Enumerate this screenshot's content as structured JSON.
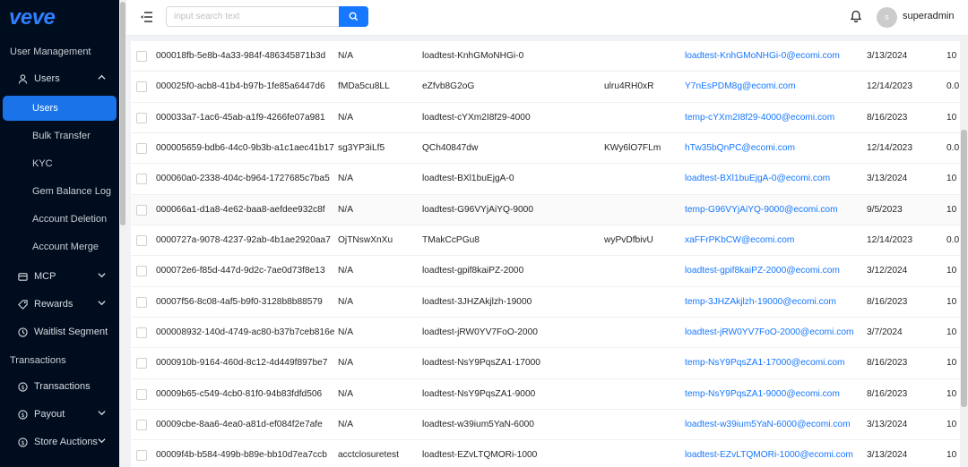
{
  "app": {
    "logo": "veve"
  },
  "sidebar": {
    "section_user_management": "User Management",
    "users_group": "Users",
    "sub_items": [
      "Users",
      "Bulk Transfer",
      "KYC",
      "Gem Balance Log",
      "Account Deletion",
      "Account Merge"
    ],
    "mcp": "MCP",
    "rewards": "Rewards",
    "waitlist": "Waitlist Segment",
    "section_transactions": "Transactions",
    "transactions": "Transactions",
    "payout": "Payout",
    "store_auctions": "Store Auctions"
  },
  "header": {
    "search_placeholder": "input search text",
    "username": "superadmin",
    "avatar_letter": "s"
  },
  "rows": [
    {
      "id": "000018fb-5e8b-4a33-984f-486345871b3d",
      "f2": "N/A",
      "f3": "loadtest-KnhGMoNHGi-0",
      "f4": "",
      "email": "loadtest-KnhGMoNHGi-0@ecomi.com",
      "date": "3/13/2024",
      "v": "10"
    },
    {
      "id": "000025f0-acb8-41b4-b97b-1fe85a6447d6",
      "f2": "fMDa5cu8LL",
      "f3": "eZfvb8G2oG",
      "f4": "ulru4RH0xR",
      "email": "Y7nEsPDM8g@ecomi.com",
      "date": "12/14/2023",
      "v": "0.0"
    },
    {
      "id": "000033a7-1ac6-45ab-a1f9-4266fe07a981",
      "f2": "N/A",
      "f3": "loadtest-cYXm2I8f29-4000",
      "f4": "",
      "email": "temp-cYXm2I8f29-4000@ecomi.com",
      "date": "8/16/2023",
      "v": "10"
    },
    {
      "id": "000005659-bdb6-44c0-9b3b-a1c1aec41b17",
      "f2": "sg3YP3iLf5",
      "f3": "QCh40847dw",
      "f4": "KWy6lO7FLm",
      "email": "hTw35bQnPC@ecomi.com",
      "date": "12/14/2023",
      "v": "0.0"
    },
    {
      "id": "000060a0-2338-404c-b964-1727685c7ba5",
      "f2": "N/A",
      "f3": "loadtest-BXl1buEjgA-0",
      "f4": "",
      "email": "loadtest-BXl1buEjgA-0@ecomi.com",
      "date": "3/13/2024",
      "v": "10"
    },
    {
      "id": "000066a1-d1a8-4e62-baa8-aefdee932c8f",
      "f2": "N/A",
      "f3": "loadtest-G96VYjAiYQ-9000",
      "f4": "",
      "email": "temp-G96VYjAiYQ-9000@ecomi.com",
      "date": "9/5/2023",
      "v": "10"
    },
    {
      "id": "0000727a-9078-4237-92ab-4b1ae2920aa7",
      "f2": "OjTNswXnXu",
      "f3": "TMakCcPGu8",
      "f4": "wyPvDfbivU",
      "email": "xaFFrPKbCW@ecomi.com",
      "date": "12/14/2023",
      "v": "0.0"
    },
    {
      "id": "000072e6-f85d-447d-9d2c-7ae0d73f8e13",
      "f2": "N/A",
      "f3": "loadtest-gpif8kaiPZ-2000",
      "f4": "",
      "email": "loadtest-gpif8kaiPZ-2000@ecomi.com",
      "date": "3/12/2024",
      "v": "10"
    },
    {
      "id": "00007f56-8c08-4af5-b9f0-3128b8b88579",
      "f2": "N/A",
      "f3": "loadtest-3JHZAkjlzh-19000",
      "f4": "",
      "email": "temp-3JHZAkjlzh-19000@ecomi.com",
      "date": "8/16/2023",
      "v": "10"
    },
    {
      "id": "000008932-140d-4749-ac80-b37b7ceb816e",
      "f2": "N/A",
      "f3": "loadtest-jRW0YV7FoO-2000",
      "f4": "",
      "email": "loadtest-jRW0YV7FoO-2000@ecomi.com",
      "date": "3/7/2024",
      "v": "10"
    },
    {
      "id": "0000910b-9164-460d-8c12-4d449f897be7",
      "f2": "N/A",
      "f3": "loadtest-NsY9PqsZA1-17000",
      "f4": "",
      "email": "temp-NsY9PqsZA1-17000@ecomi.com",
      "date": "8/16/2023",
      "v": "10"
    },
    {
      "id": "00009b65-c549-4cb0-81f0-94b83fdfd506",
      "f2": "N/A",
      "f3": "loadtest-NsY9PqsZA1-9000",
      "f4": "",
      "email": "temp-NsY9PqsZA1-9000@ecomi.com",
      "date": "8/16/2023",
      "v": "10"
    },
    {
      "id": "00009cbe-8aa6-4ea0-a81d-ef084f2e7afe",
      "f2": "N/A",
      "f3": "loadtest-w39ium5YaN-6000",
      "f4": "",
      "email": "loadtest-w39ium5YaN-6000@ecomi.com",
      "date": "3/13/2024",
      "v": "10"
    },
    {
      "id": "00009f4b-b584-499b-b89e-bb10d7ea7ccb",
      "f2": "acctclosuretest",
      "f3": "loadtest-EZvLTQMORi-1000",
      "f4": "",
      "email": "loadtest-EZvLTQMORi-1000@ecomi.com",
      "date": "3/13/2024",
      "v": "10"
    }
  ]
}
